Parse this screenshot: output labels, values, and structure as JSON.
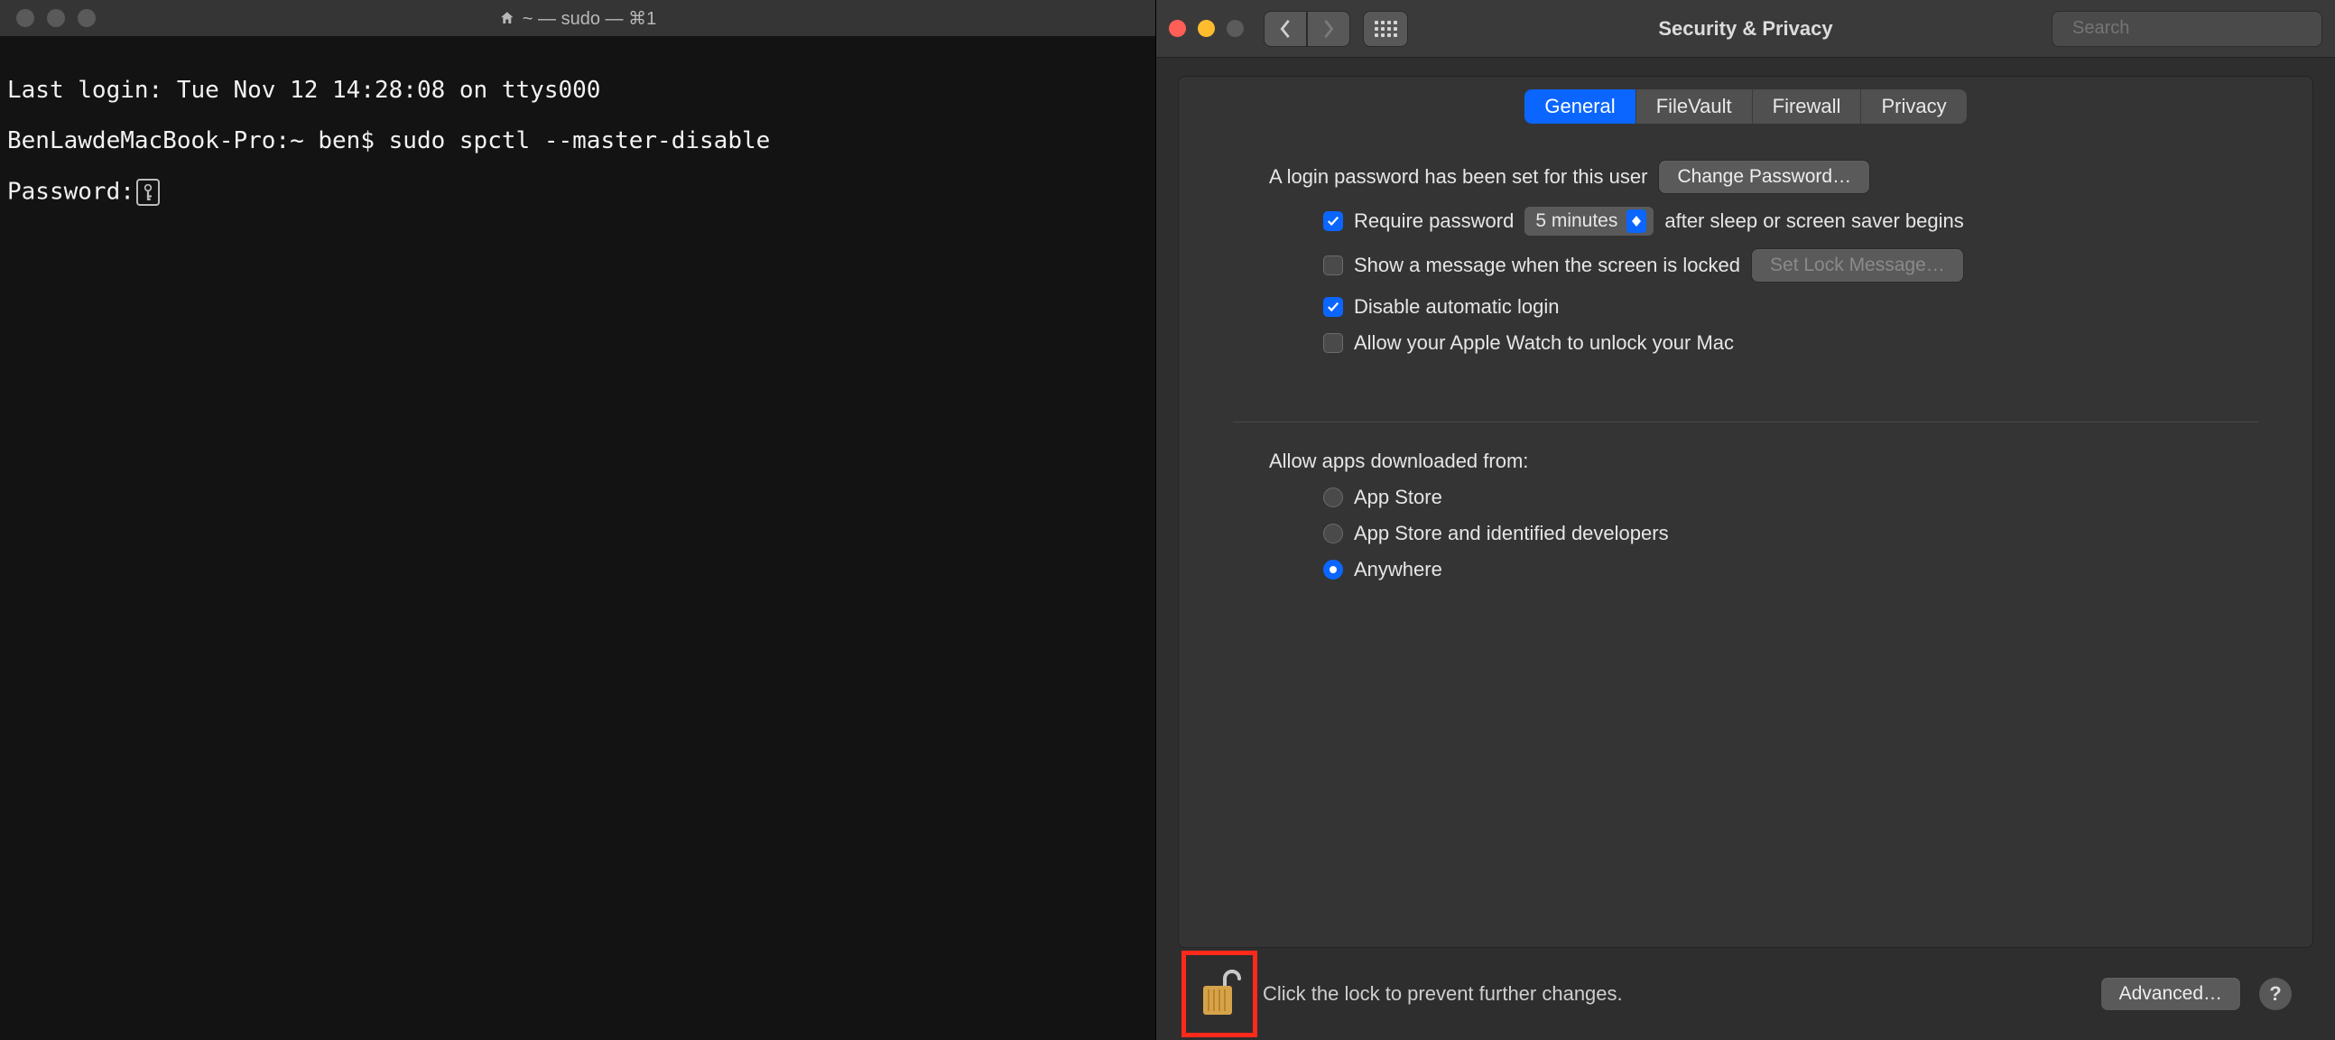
{
  "terminal": {
    "title": "~ — sudo — ⌘1",
    "line1": "Last login: Tue Nov 12 14:28:08 on ttys000",
    "line2": "BenLawdeMacBook-Pro:~ ben$ sudo spctl --master-disable",
    "password_label": "Password:"
  },
  "prefs": {
    "title": "Security & Privacy",
    "search_placeholder": "Search",
    "tabs": {
      "general": "General",
      "filevault": "FileVault",
      "firewall": "Firewall",
      "privacy": "Privacy"
    },
    "login_set_text": "A login password has been set for this user",
    "change_password_btn": "Change Password…",
    "require_pw_label": "Require password",
    "delay_value": "5 minutes",
    "after_sleep_text": "after sleep or screen saver begins",
    "show_message_label": "Show a message when the screen is locked",
    "set_lock_msg_btn": "Set Lock Message…",
    "disable_autologin_label": "Disable automatic login",
    "watch_label": "Allow your Apple Watch to unlock your Mac",
    "allow_apps_label": "Allow apps downloaded from:",
    "radio_appstore": "App Store",
    "radio_identified": "App Store and identified developers",
    "radio_anywhere": "Anywhere",
    "lock_text": "Click the lock to prevent further changes.",
    "advanced_btn": "Advanced…",
    "help_label": "?"
  }
}
